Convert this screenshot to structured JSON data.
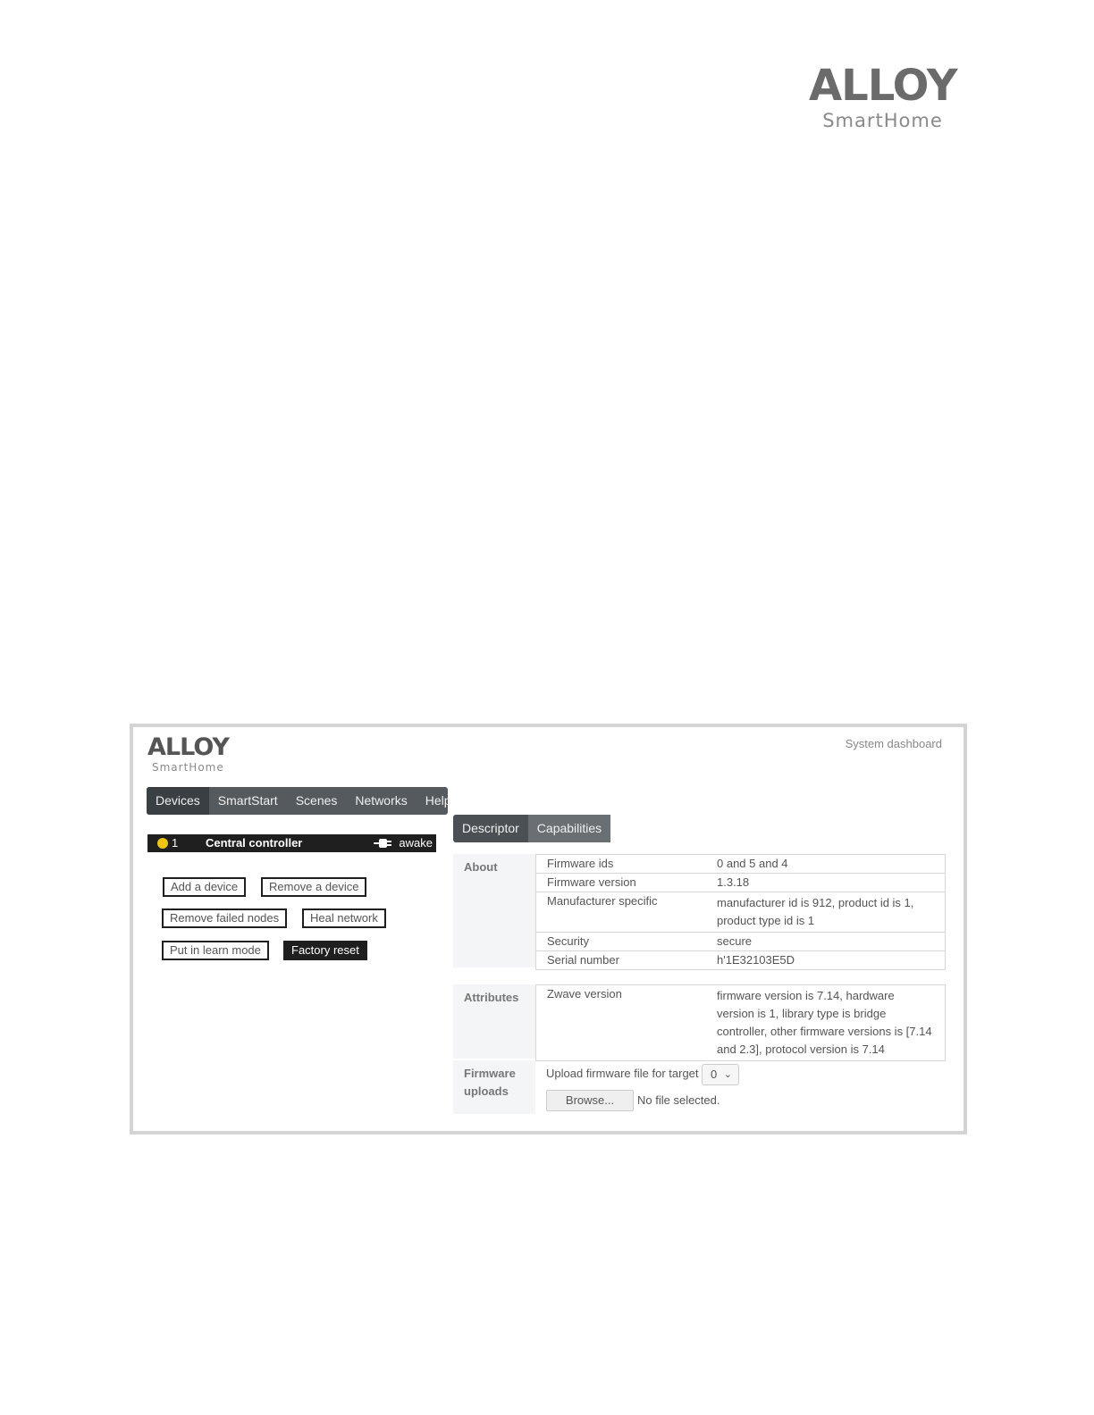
{
  "page_logo": {
    "brand": "ALLOY",
    "sub": "SmartHome"
  },
  "app": {
    "logo": {
      "brand": "ALLOY",
      "sub": "SmartHome"
    },
    "system_dashboard": "System dashboard",
    "nav": [
      "Devices",
      "SmartStart",
      "Scenes",
      "Networks",
      "Help"
    ],
    "device": {
      "status_color": "#f1c40f",
      "id": "1",
      "name": "Central controller",
      "power_icon": "plug-icon",
      "state": "awake"
    },
    "actions": {
      "add": "Add a device",
      "remove": "Remove a device",
      "remove_failed": "Remove failed nodes",
      "heal": "Heal network",
      "learn": "Put in learn mode",
      "factory_reset": "Factory reset"
    },
    "tabs": [
      "Descriptor",
      "Capabilities"
    ],
    "about": {
      "label": "About",
      "rows": [
        {
          "key": "Firmware ids",
          "value": "0 and 5 and 4"
        },
        {
          "key": "Firmware version",
          "value": "1.3.18"
        },
        {
          "key": "Manufacturer specific",
          "value": "manufacturer id is 912, product id is 1, product type id is 1"
        },
        {
          "key": "Security",
          "value": "secure"
        },
        {
          "key": "Serial number",
          "value": "h'1E32103E5D"
        }
      ]
    },
    "attributes": {
      "label": "Attributes",
      "rows": [
        {
          "key": "Zwave version",
          "value": "firmware version is 7.14, hardware version is 1, library type is bridge controller, other firmware versions is [7.14 and 2.3], protocol version is 7.14"
        }
      ]
    },
    "firmware_uploads": {
      "label": "Firmware uploads",
      "prompt": "Upload firmware file for target",
      "target": "0",
      "browse": "Browse...",
      "file_status": "No file selected."
    }
  }
}
